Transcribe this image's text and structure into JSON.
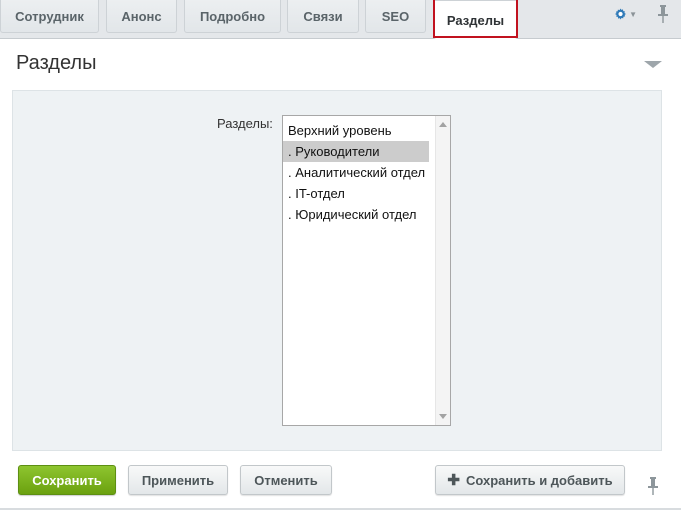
{
  "tabs": [
    {
      "label": "Сотрудник",
      "active": false
    },
    {
      "label": "Анонс",
      "active": false
    },
    {
      "label": "Подробно",
      "active": false
    },
    {
      "label": "Связи",
      "active": false
    },
    {
      "label": "SEO",
      "active": false
    },
    {
      "label": "Разделы",
      "active": true
    }
  ],
  "icons": {
    "settings": "gear-icon",
    "pin": "pin-icon",
    "collapse": "collapse-arrow-icon",
    "add": "plus-icon"
  },
  "colors": {
    "accent_blue": "#2f7ab8",
    "save_green": "#7bb31f",
    "highlight_red": "#c1121f"
  },
  "section": {
    "title": "Разделы"
  },
  "field": {
    "label": "Разделы:",
    "options": [
      "Верхний уровень",
      ". Руководители",
      ". Аналитический отдел",
      ". IT-отдел",
      ". Юридический отдел"
    ],
    "selected": ". Руководители"
  },
  "buttons": {
    "save": "Сохранить",
    "apply": "Применить",
    "cancel": "Отменить",
    "save_and_add": "Сохранить и добавить"
  }
}
